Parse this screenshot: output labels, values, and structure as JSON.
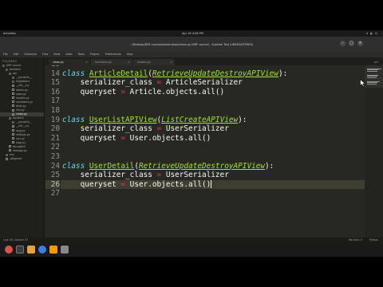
{
  "system": {
    "activities": "Activities",
    "clock": "Apr 18  4:08 PM",
    "tray": "▾ ◐ ⏻"
  },
  "window": {
    "title": "~/Desktop/DRF-course/backend/api/views.py (DRF course) - Sublime Text (UNREGISTERED)",
    "minimize": "–",
    "maximize": "□",
    "close": "×"
  },
  "menu": [
    "File",
    "Edit",
    "Selection",
    "Find",
    "View",
    "Goto",
    "Tools",
    "Project",
    "Preferences",
    "Help"
  ],
  "sidebar": {
    "header": "FOLDERS",
    "items": [
      {
        "label": "DRF course",
        "type": "folder",
        "indent": 0
      },
      {
        "label": "backend",
        "type": "folder",
        "indent": 1
      },
      {
        "label": "api",
        "type": "folder",
        "indent": 2
      },
      {
        "label": "__pycache__",
        "type": "folder",
        "indent": 3
      },
      {
        "label": "migrations",
        "type": "folder",
        "indent": 3
      },
      {
        "label": "__init__.py",
        "type": "file",
        "indent": 3
      },
      {
        "label": "admin.py",
        "type": "file",
        "indent": 3
      },
      {
        "label": "apps.py",
        "type": "file",
        "indent": 3
      },
      {
        "label": "models.py",
        "type": "file",
        "indent": 3
      },
      {
        "label": "serializers.py",
        "type": "file",
        "indent": 3
      },
      {
        "label": "tests.py",
        "type": "file",
        "indent": 3
      },
      {
        "label": "urls.py",
        "type": "file",
        "indent": 3
      },
      {
        "label": "views.py",
        "type": "file",
        "indent": 3,
        "selected": true
      },
      {
        "label": "backend",
        "type": "folder",
        "indent": 2
      },
      {
        "label": "__pycache__",
        "type": "folder",
        "indent": 3
      },
      {
        "label": "__init__.py",
        "type": "file",
        "indent": 3
      },
      {
        "label": "asgi.py",
        "type": "file",
        "indent": 3
      },
      {
        "label": "settings.py",
        "type": "file",
        "indent": 3
      },
      {
        "label": "urls.py",
        "type": "file",
        "indent": 3
      },
      {
        "label": "wsgi.py",
        "type": "file",
        "indent": 3
      },
      {
        "label": "db.sqlite3",
        "type": "file",
        "indent": 2
      },
      {
        "label": "manage.py",
        "type": "file",
        "indent": 2
      },
      {
        "label": "env",
        "type": "folder",
        "indent": 1
      },
      {
        "label": ".gitignore",
        "type": "file",
        "indent": 1
      }
    ]
  },
  "tabs": [
    {
      "label": "views.py",
      "active": true
    },
    {
      "label": "serializers.py",
      "active": false
    },
    {
      "label": "models.py",
      "active": false
    }
  ],
  "editor": {
    "current_line": 26,
    "lines": [
      {
        "n": 13,
        "tokens": []
      },
      {
        "n": 14,
        "tokens": [
          [
            "kw",
            "class "
          ],
          [
            "cls",
            "ArticleDetail"
          ],
          [
            "p",
            "("
          ],
          [
            "inh",
            "RetrieveUpdateDestroyAPIView"
          ],
          [
            "p",
            "):"
          ]
        ]
      },
      {
        "n": 15,
        "tokens": [
          [
            "p",
            "    serializer_class "
          ],
          [
            "op",
            "="
          ],
          [
            "p",
            " ArticleSerializer"
          ]
        ]
      },
      {
        "n": 16,
        "tokens": [
          [
            "p",
            "    queryset "
          ],
          [
            "op",
            "="
          ],
          [
            "p",
            " Article.objects.all()"
          ]
        ]
      },
      {
        "n": 17,
        "tokens": []
      },
      {
        "n": 18,
        "tokens": []
      },
      {
        "n": 19,
        "tokens": [
          [
            "kw",
            "class "
          ],
          [
            "cls",
            "UserListAPIView"
          ],
          [
            "p",
            "("
          ],
          [
            "inh",
            "ListCreateAPIView"
          ],
          [
            "p",
            "):"
          ]
        ]
      },
      {
        "n": 20,
        "tokens": [
          [
            "p",
            "    serializer_class "
          ],
          [
            "op",
            "="
          ],
          [
            "p",
            " UserSerializer"
          ]
        ]
      },
      {
        "n": 21,
        "tokens": [
          [
            "p",
            "    queryset "
          ],
          [
            "op",
            "="
          ],
          [
            "p",
            " User.objects.all()"
          ]
        ]
      },
      {
        "n": 22,
        "tokens": []
      },
      {
        "n": 23,
        "tokens": []
      },
      {
        "n": 24,
        "tokens": [
          [
            "kw",
            "class "
          ],
          [
            "cls",
            "UserDetail"
          ],
          [
            "p",
            "("
          ],
          [
            "inh",
            "RetrieveUpdateDestroyAPIView"
          ],
          [
            "p",
            "):"
          ]
        ]
      },
      {
        "n": 25,
        "tokens": [
          [
            "p",
            "    serializer_class "
          ],
          [
            "op",
            "="
          ],
          [
            "p",
            " UserSerializer"
          ]
        ]
      },
      {
        "n": 26,
        "tokens": [
          [
            "p",
            "    queryset "
          ],
          [
            "op",
            "="
          ],
          [
            "p",
            " User.objects.all()"
          ]
        ]
      },
      {
        "n": 27,
        "tokens": []
      }
    ]
  },
  "status": {
    "left": "Line 26, Column 37",
    "tab_size": "Tab Size: 4",
    "syntax": "Python"
  },
  "colors": {
    "background": "#272822",
    "keyword": "#66d9ef",
    "class_name": "#a6e22e",
    "operator": "#f92672",
    "text": "#f8f8f2"
  },
  "taskbar_apps": [
    "ubuntu-icon",
    "terminal-icon",
    "files-icon",
    "browser-icon",
    "sublime-icon",
    "settings-icon"
  ]
}
